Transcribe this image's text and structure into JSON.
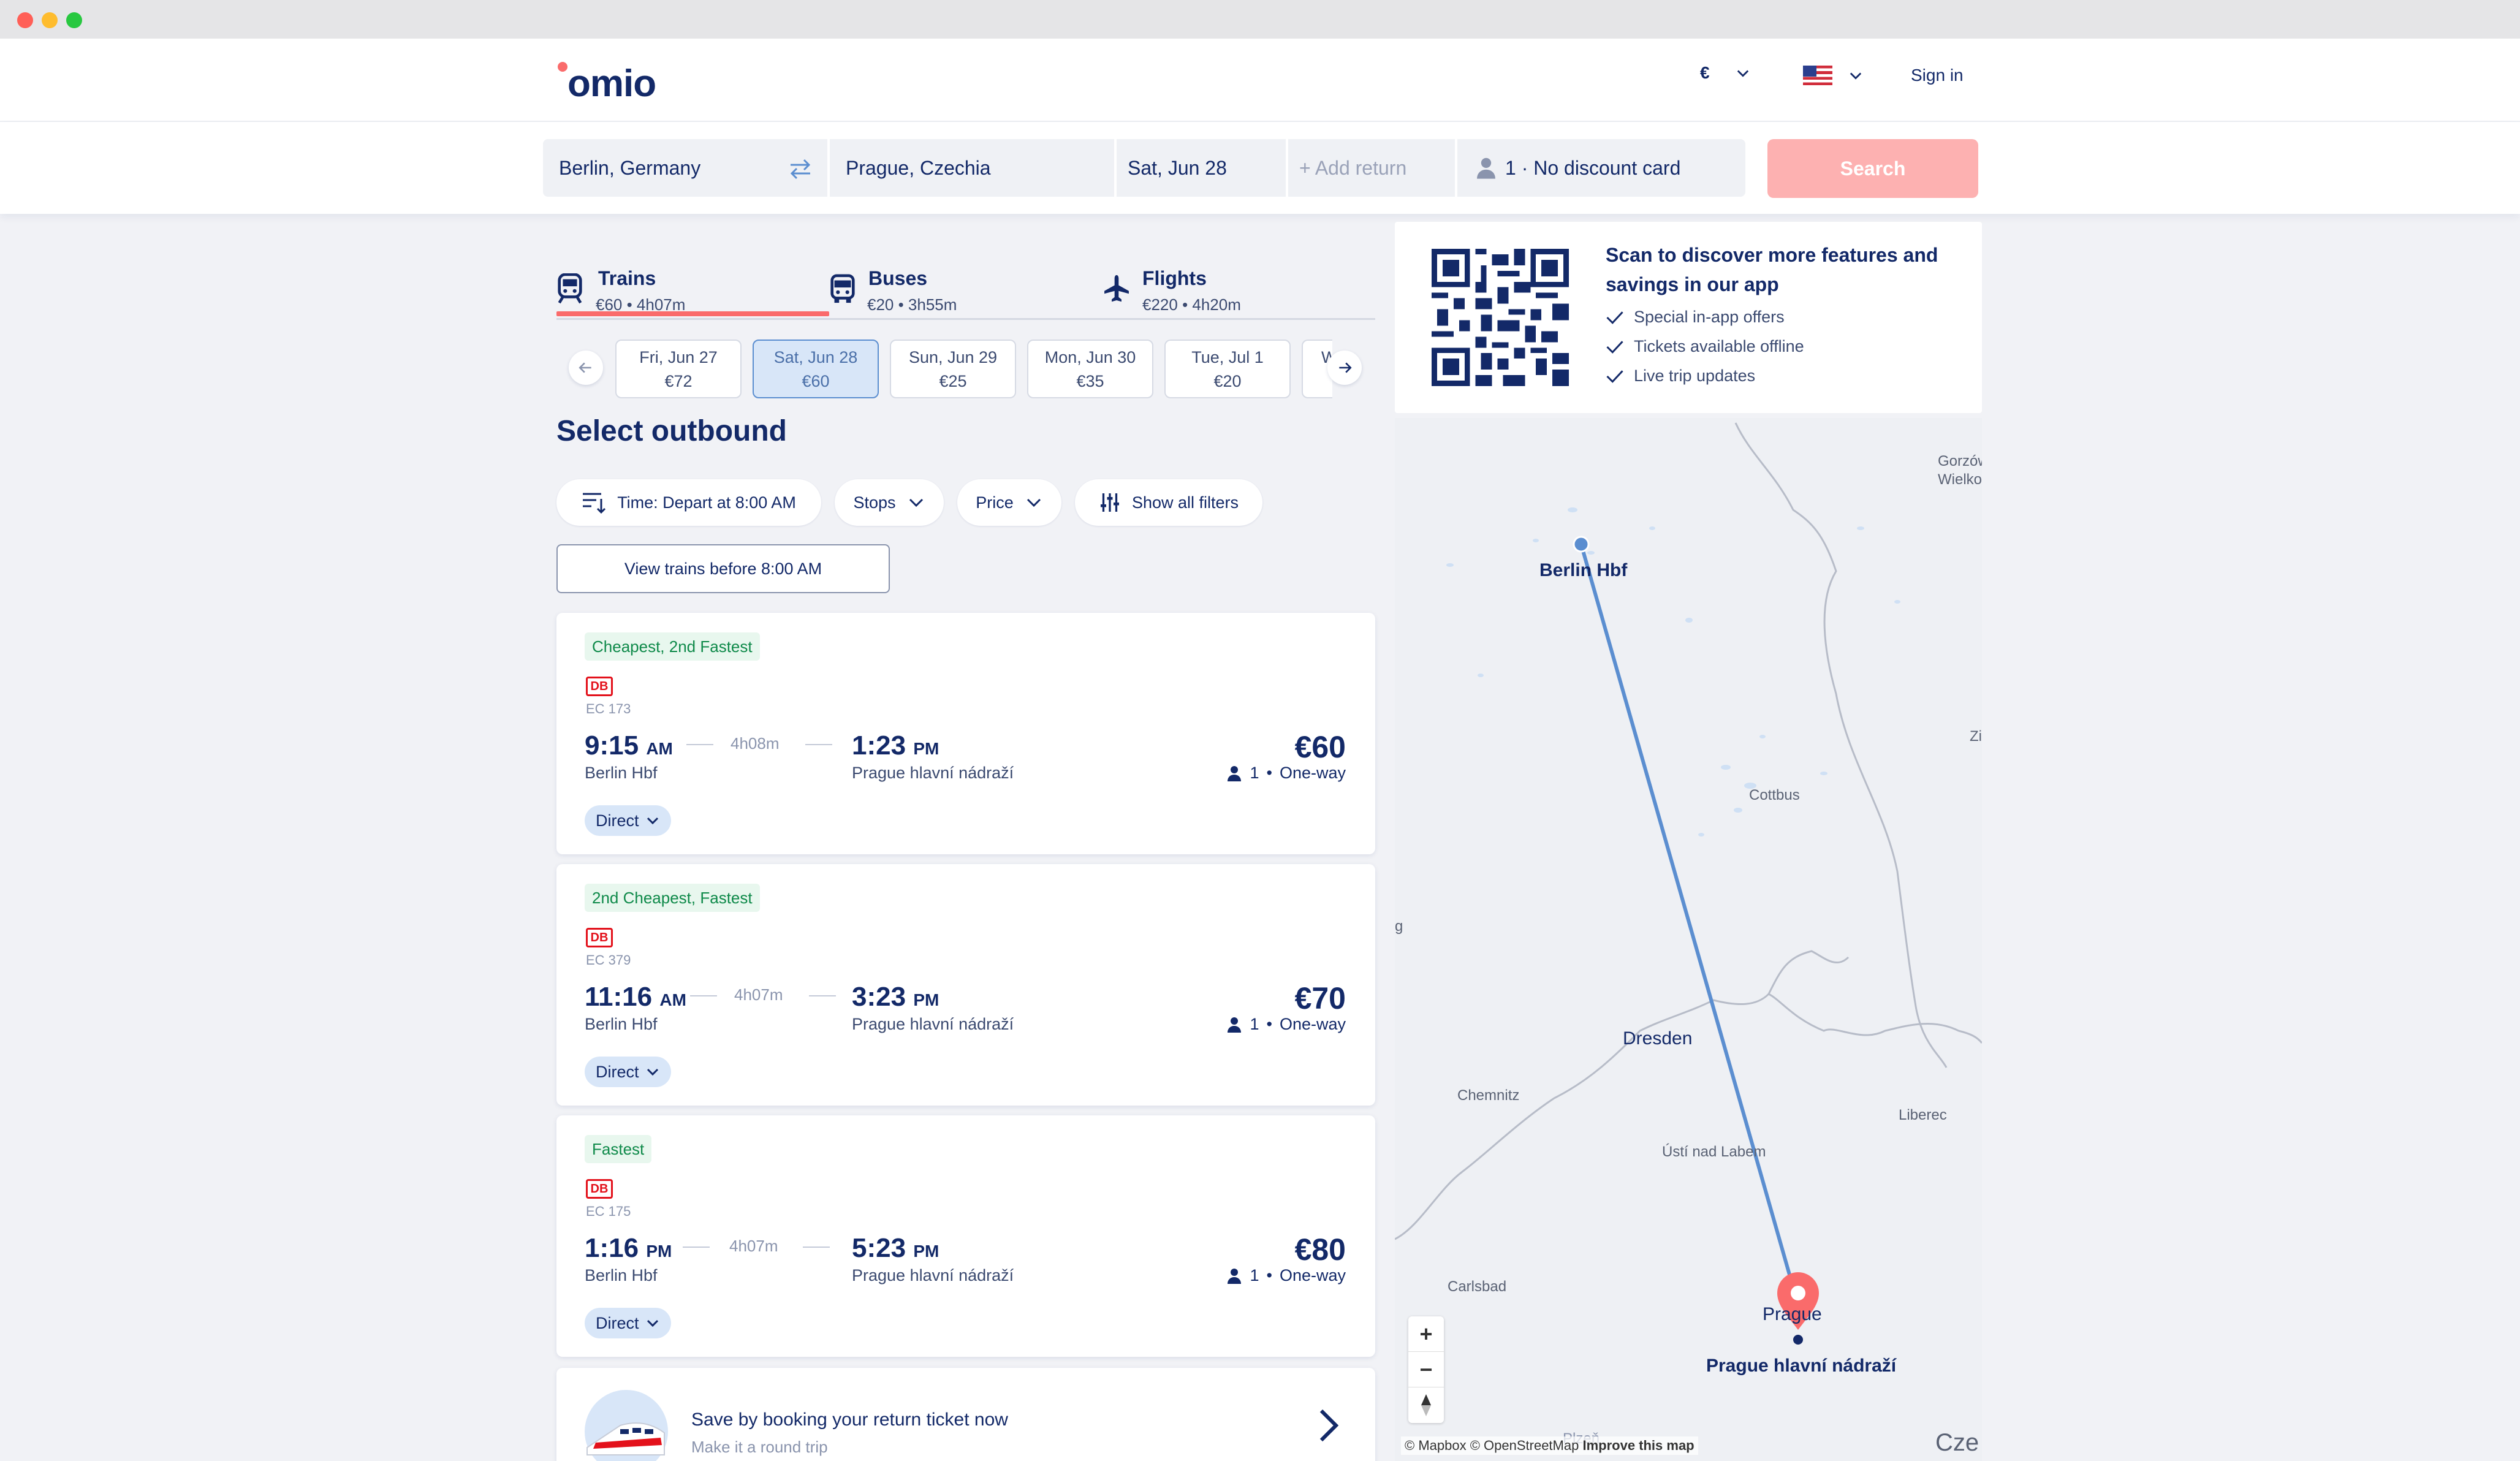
{
  "header": {
    "logo": "omio",
    "currency": "€",
    "signin": "Sign in",
    "language_flag": "us-flag"
  },
  "search": {
    "from": "Berlin, Germany",
    "to": "Prague, Czechia",
    "date": "Sat, Jun 28",
    "return_placeholder": "+ Add return",
    "passengers": "1 · No discount card",
    "button": "Search"
  },
  "tabs": [
    {
      "label": "Trains",
      "sub": "€60 • 4h07m",
      "icon": "train-icon"
    },
    {
      "label": "Buses",
      "sub": "€20 • 3h55m",
      "icon": "bus-icon"
    },
    {
      "label": "Flights",
      "sub": "€220 • 4h20m",
      "icon": "plane-icon"
    }
  ],
  "dates": [
    {
      "day": "Fri, Jun 27",
      "price": "€72"
    },
    {
      "day": "Sat, Jun 28",
      "price": "€60"
    },
    {
      "day": "Sun, Jun 29",
      "price": "€25"
    },
    {
      "day": "Mon, Jun 30",
      "price": "€35"
    },
    {
      "day": "Tue, Jul 1",
      "price": "€20"
    },
    {
      "day": "W",
      "price": ""
    }
  ],
  "page_title": "Select outbound",
  "filters": {
    "time": "Time: Depart at 8:00 AM",
    "stops": "Stops",
    "price": "Price",
    "all": "Show all filters",
    "view_before": "View trains before 8:00 AM"
  },
  "results": [
    {
      "badge": "Cheapest, 2nd Fastest",
      "operator": "DB",
      "train": "EC 173",
      "dep": "9:15",
      "dep_ampm": "AM",
      "duration": "4h08m",
      "arr": "1:23",
      "arr_ampm": "PM",
      "dep_station": "Berlin Hbf",
      "arr_station": "Prague hlavní nádraží",
      "price": "€60",
      "pax": "1",
      "trip": "One-way",
      "stops": "Direct"
    },
    {
      "badge": "2nd Cheapest, Fastest",
      "operator": "DB",
      "train": "EC 379",
      "dep": "11:16",
      "dep_ampm": "AM",
      "duration": "4h07m",
      "arr": "3:23",
      "arr_ampm": "PM",
      "dep_station": "Berlin Hbf",
      "arr_station": "Prague hlavní nádraží",
      "price": "€70",
      "pax": "1",
      "trip": "One-way",
      "stops": "Direct"
    },
    {
      "badge": "Fastest",
      "operator": "DB",
      "train": "EC 175",
      "dep": "1:16",
      "dep_ampm": "PM",
      "duration": "4h07m",
      "arr": "5:23",
      "arr_ampm": "PM",
      "dep_station": "Berlin Hbf",
      "arr_station": "Prague hlavní nádraží",
      "price": "€80",
      "pax": "1",
      "trip": "One-way",
      "stops": "Direct"
    }
  ],
  "promo": {
    "title": "Save by booking your return ticket now",
    "sub": "Make it a round trip"
  },
  "app_promo": {
    "title": "Scan to discover more features and savings in our app",
    "items": [
      "Special in-app offers",
      "Tickets available offline",
      "Live trip updates"
    ]
  },
  "map": {
    "labels": {
      "gorzow": "Gorzów\nWielkopo",
      "berlin": "Berlin Hbf",
      "zi": "Zi",
      "cottbus": "Cottbus",
      "g": "g",
      "dresden": "Dresden",
      "chemnitz": "Chemnitz",
      "liberec": "Liberec",
      "usti": "Ústí nad Labem",
      "carlsbad": "Carlsbad",
      "prague": "Prague",
      "prague_station": "Prague hlavní nádraží",
      "pilsen": "Plzeň",
      "czech": "Cze"
    },
    "zoom_in": "+",
    "zoom_out": "−",
    "attribution": "© Mapbox © OpenStreetMap",
    "improve": "Improve this map"
  },
  "colors": {
    "brand_navy": "#132968",
    "brand_coral": "#fa6b6b",
    "route_blue": "#5b8ed0",
    "badge_green": "#0f8a4a"
  }
}
